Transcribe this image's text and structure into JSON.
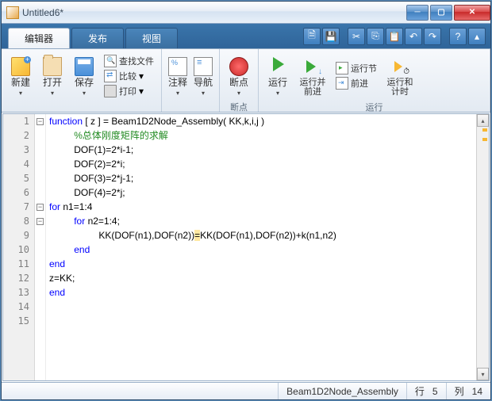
{
  "window": {
    "title": "Untitled6*"
  },
  "tabs": {
    "editor": "编辑器",
    "publish": "发布",
    "view": "视图"
  },
  "ribbon": {
    "new": "新建",
    "open": "打开",
    "save": "保存",
    "find": "查找文件",
    "compare": "比较",
    "print": "打印",
    "insert": "注释",
    "nav": "导航",
    "bp": "断点",
    "run": "运行",
    "runadv": "运行并\n前进",
    "sect": "运行节",
    "adv": "前进",
    "time": "运行和\n计时",
    "g_file": "",
    "g_nav": "",
    "g_bp": "断点",
    "g_run": "运行"
  },
  "code": {
    "l1a": "function",
    "l1b": " [ z ] = Beam1D2Node_Assembly( KK,k,i,j )",
    "l2": "%总体刚度矩阵的求解",
    "l3": "DOF(1)=2*i-1;",
    "l4": "DOF(2)=2*i;",
    "l5": "DOF(3)=2*j-1;",
    "l6": "DOF(4)=2*j;",
    "l7a": "for",
    "l7b": " n1=1:4",
    "l8a": "for",
    "l8b": " n2=1:4;",
    "l9a": "KK(DOF(n1),DOF(n2))",
    "l9b": "=",
    "l9c": "KK(DOF(n1),DOF(n2))+k(n1,n2)",
    "l10": "end",
    "l11": "end",
    "l12": "z=KK;",
    "l13": "end"
  },
  "lines": [
    "1",
    "2",
    "3",
    "4",
    "5",
    "6",
    "7",
    "8",
    "9",
    "10",
    "11",
    "12",
    "13",
    "14",
    "15"
  ],
  "status": {
    "fn": "Beam1D2Node_Assembly",
    "row_lbl": "行",
    "row": "5",
    "col_lbl": "列",
    "col": "14"
  }
}
